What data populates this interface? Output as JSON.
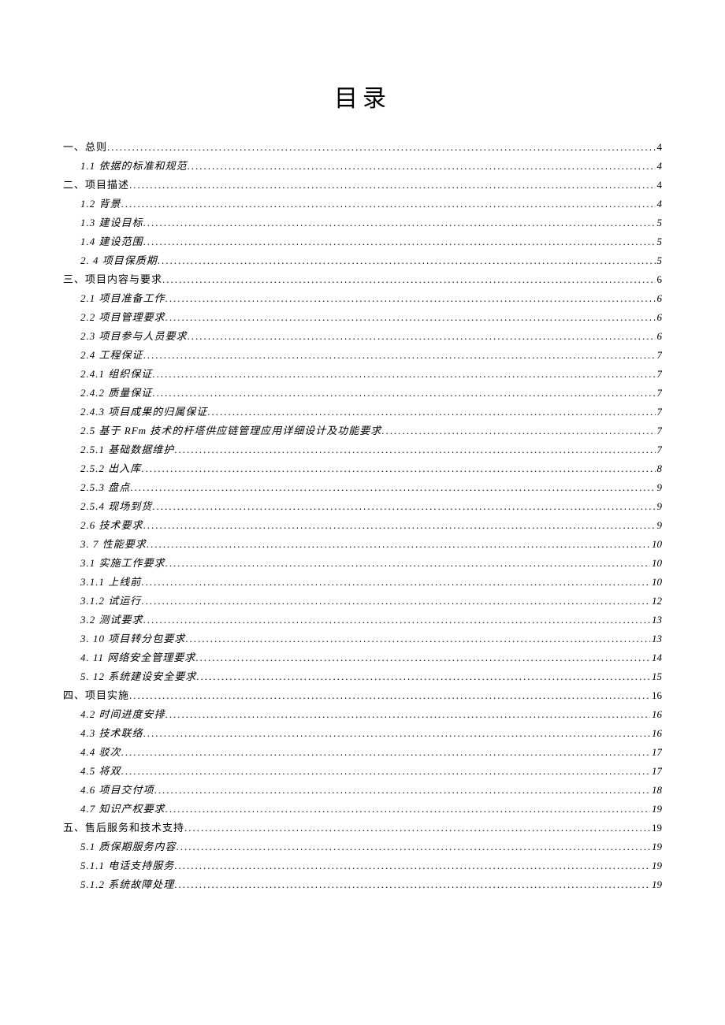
{
  "title": "目录",
  "toc": [
    {
      "level": 0,
      "italic": false,
      "label": "一、总则",
      "page": "4"
    },
    {
      "level": 1,
      "italic": true,
      "label": "1.1  依据的标准和规范",
      "page": "4"
    },
    {
      "level": 0,
      "italic": false,
      "label": "二、项目描述",
      "page": "4"
    },
    {
      "level": 1,
      "italic": true,
      "label": "1.2  背景",
      "page": "4"
    },
    {
      "level": 1,
      "italic": true,
      "label": "1.3  建设目标",
      "page": "5"
    },
    {
      "level": 1,
      "italic": true,
      "label": "1.4  建设范围",
      "page": "5"
    },
    {
      "level": 1,
      "italic": true,
      "label": "2.    4 项目保质期",
      "page": "5"
    },
    {
      "level": 0,
      "italic": false,
      "label": "三、项目内容与要求",
      "page": "6"
    },
    {
      "level": 1,
      "italic": true,
      "label": "2.1  项目准备工作",
      "page": "6"
    },
    {
      "level": 1,
      "italic": true,
      "label": "2.2  项目管理要求",
      "page": "6"
    },
    {
      "level": 1,
      "italic": true,
      "label": "2.3  项目参与人员要求",
      "page": "6"
    },
    {
      "level": 1,
      "italic": true,
      "label": "2.4  工程保证",
      "page": "7"
    },
    {
      "level": 2,
      "italic": true,
      "label": "2.4.1  组织保证",
      "page": "7"
    },
    {
      "level": 2,
      "italic": true,
      "label": "2.4.2  质量保证",
      "page": "7"
    },
    {
      "level": 2,
      "italic": true,
      "label": "2.4.3  项目成果的归属保证",
      "page": "7"
    },
    {
      "level": 1,
      "italic": true,
      "label": "2.5  基于 RFm 技术的杆塔供应链管理应用详细设计及功能要求",
      "page": "7"
    },
    {
      "level": 2,
      "italic": true,
      "label": "2.5.1   基础数据维护",
      "page": "7"
    },
    {
      "level": 2,
      "italic": true,
      "label": "2.5.2   出入库",
      "page": "8"
    },
    {
      "level": 2,
      "italic": true,
      "label": "2.5.3  盘点",
      "page": "9"
    },
    {
      "level": 2,
      "italic": true,
      "label": "2.5.4   现场到货",
      "page": "9"
    },
    {
      "level": 1,
      "italic": true,
      "label": "2.6  技术要求",
      "page": "9"
    },
    {
      "level": 1,
      "italic": true,
      "label": "3.    7 性能要求",
      "page": "10"
    },
    {
      "level": 1,
      "italic": true,
      "label": "3.1  实施工作要求",
      "page": "10"
    },
    {
      "level": 2,
      "italic": true,
      "label": "3.1.1  上线前",
      "page": "10"
    },
    {
      "level": 2,
      "italic": true,
      "label": "3.1.2  试运行",
      "page": "12"
    },
    {
      "level": 1,
      "italic": true,
      "label": "3.2  测试要求",
      "page": "13"
    },
    {
      "level": 1,
      "italic": true,
      "label": "3.    10 项目转分包要求",
      "page": "13"
    },
    {
      "level": 1,
      "italic": true,
      "label": "4.    11 网络安全管理要求",
      "page": "14"
    },
    {
      "level": 1,
      "italic": true,
      "label": "5.    12 系统建设安全要求",
      "page": "15"
    },
    {
      "level": 0,
      "italic": false,
      "label": "四、项目实施",
      "page": "16"
    },
    {
      "level": 1,
      "italic": true,
      "label": "4.2  时间进度安排",
      "page": "16"
    },
    {
      "level": 1,
      "italic": true,
      "label": "4.3  技术联络",
      "page": "16"
    },
    {
      "level": 1,
      "italic": true,
      "label": "4.4  驳次",
      "page": "17"
    },
    {
      "level": 1,
      "italic": true,
      "label": "4.5  将双",
      "page": "17"
    },
    {
      "level": 1,
      "italic": true,
      "label": "4.6  项目交付项",
      "page": "18"
    },
    {
      "level": 1,
      "italic": true,
      "label": "4.7  知识产权要求",
      "page": "19"
    },
    {
      "level": 0,
      "italic": false,
      "label": "五、售后服务和技术支持",
      "page": "19"
    },
    {
      "level": 1,
      "italic": true,
      "label": "5.1  质保期服务内容",
      "page": "19"
    },
    {
      "level": 2,
      "italic": true,
      "label": "5.1.1  电话支持服务",
      "page": "19"
    },
    {
      "level": 2,
      "italic": true,
      "label": "5.1.2  系统故障处理",
      "page": "19"
    }
  ]
}
